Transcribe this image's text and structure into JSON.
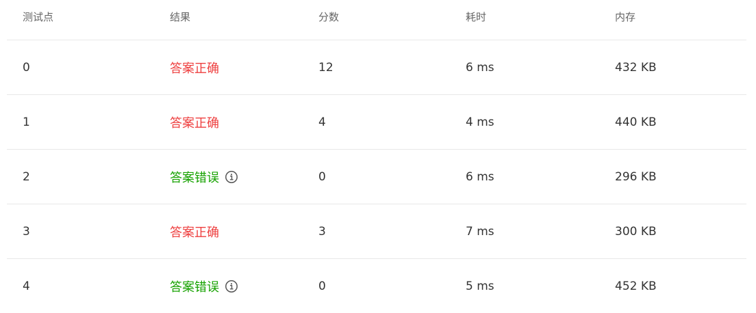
{
  "columns": [
    "测试点",
    "结果",
    "分数",
    "耗时",
    "内存"
  ],
  "colors": {
    "correct": "#ee3f3f",
    "wrong": "#16a200",
    "header_text": "#666666",
    "divider": "#e8e8e8"
  },
  "rows": [
    {
      "id": "0",
      "result": "答案正确",
      "status": "correct",
      "score": "12",
      "time": "6 ms",
      "memory": "432 KB"
    },
    {
      "id": "1",
      "result": "答案正确",
      "status": "correct",
      "score": "4",
      "time": "4 ms",
      "memory": "440 KB"
    },
    {
      "id": "2",
      "result": "答案错误",
      "status": "wrong",
      "info_icon": "info-icon",
      "score": "0",
      "time": "6 ms",
      "memory": "296 KB"
    },
    {
      "id": "3",
      "result": "答案正确",
      "status": "correct",
      "score": "3",
      "time": "7 ms",
      "memory": "300 KB"
    },
    {
      "id": "4",
      "result": "答案错误",
      "status": "wrong",
      "info_icon": "info-icon",
      "score": "0",
      "time": "5 ms",
      "memory": "452 KB"
    }
  ]
}
